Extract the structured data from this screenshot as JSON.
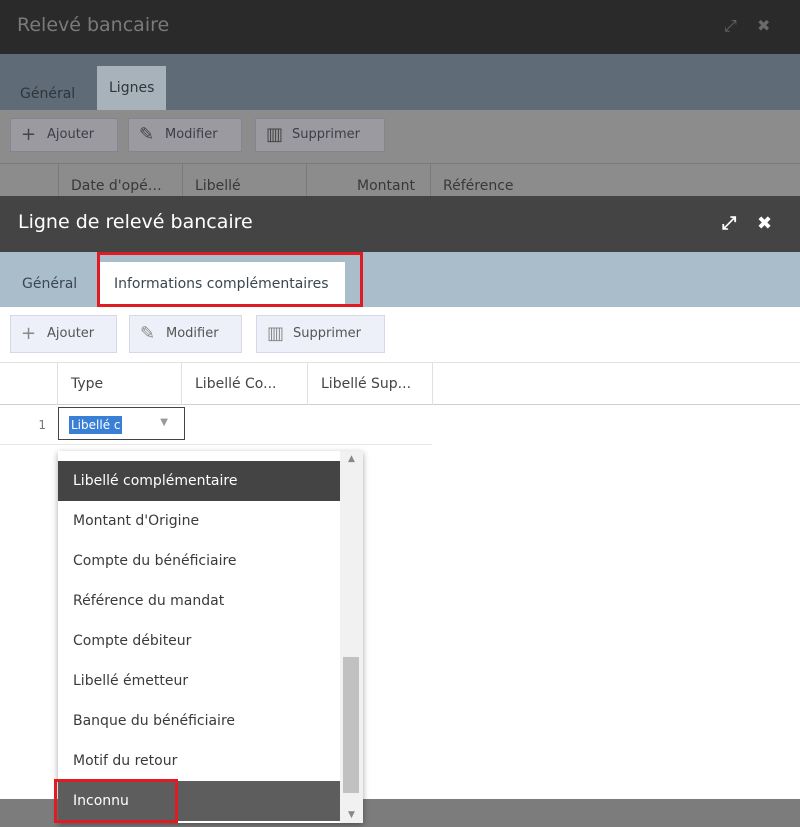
{
  "back_window": {
    "title": "Relevé bancaire",
    "tabs": [
      {
        "label": "Général"
      },
      {
        "label": "Lignes"
      }
    ],
    "toolbar": {
      "add": "Ajouter",
      "edit": "Modifier",
      "delete": "Supprimer"
    },
    "columns": [
      "Date d'opé…",
      "Libellé",
      "Montant",
      "Référence"
    ]
  },
  "dialog": {
    "title": "Ligne de relevé bancaire",
    "tabs": [
      {
        "label": "Général"
      },
      {
        "label": "Informations complémentaires"
      }
    ],
    "toolbar": {
      "add": "Ajouter",
      "edit": "Modifier",
      "delete": "Supprimer"
    },
    "columns": [
      "Type",
      "Libellé Co...",
      "Libellé Sup..."
    ],
    "rows": [
      {
        "num": "1",
        "type_value": "Libellé c"
      }
    ]
  },
  "dropdown": {
    "options": [
      "Libellé complémentaire",
      "Montant d'Origine",
      "Compte du bénéficiaire",
      "Référence du mandat",
      "Compte débiteur",
      "Libellé émetteur",
      "Banque du bénéficiaire",
      "Motif du retour",
      "Inconnu"
    ],
    "selected_index": 0,
    "hover_index": 8
  },
  "icons": {
    "expand": "expand-icon",
    "close": "close-icon",
    "add": "plus-icon",
    "edit": "pencil-icon",
    "delete": "trash-icon"
  },
  "colors": {
    "dialog_titlebar": "#444444",
    "tab_strip": "#a9bdcb",
    "highlight": "#e01b24",
    "selection": "#3a7fd6"
  }
}
